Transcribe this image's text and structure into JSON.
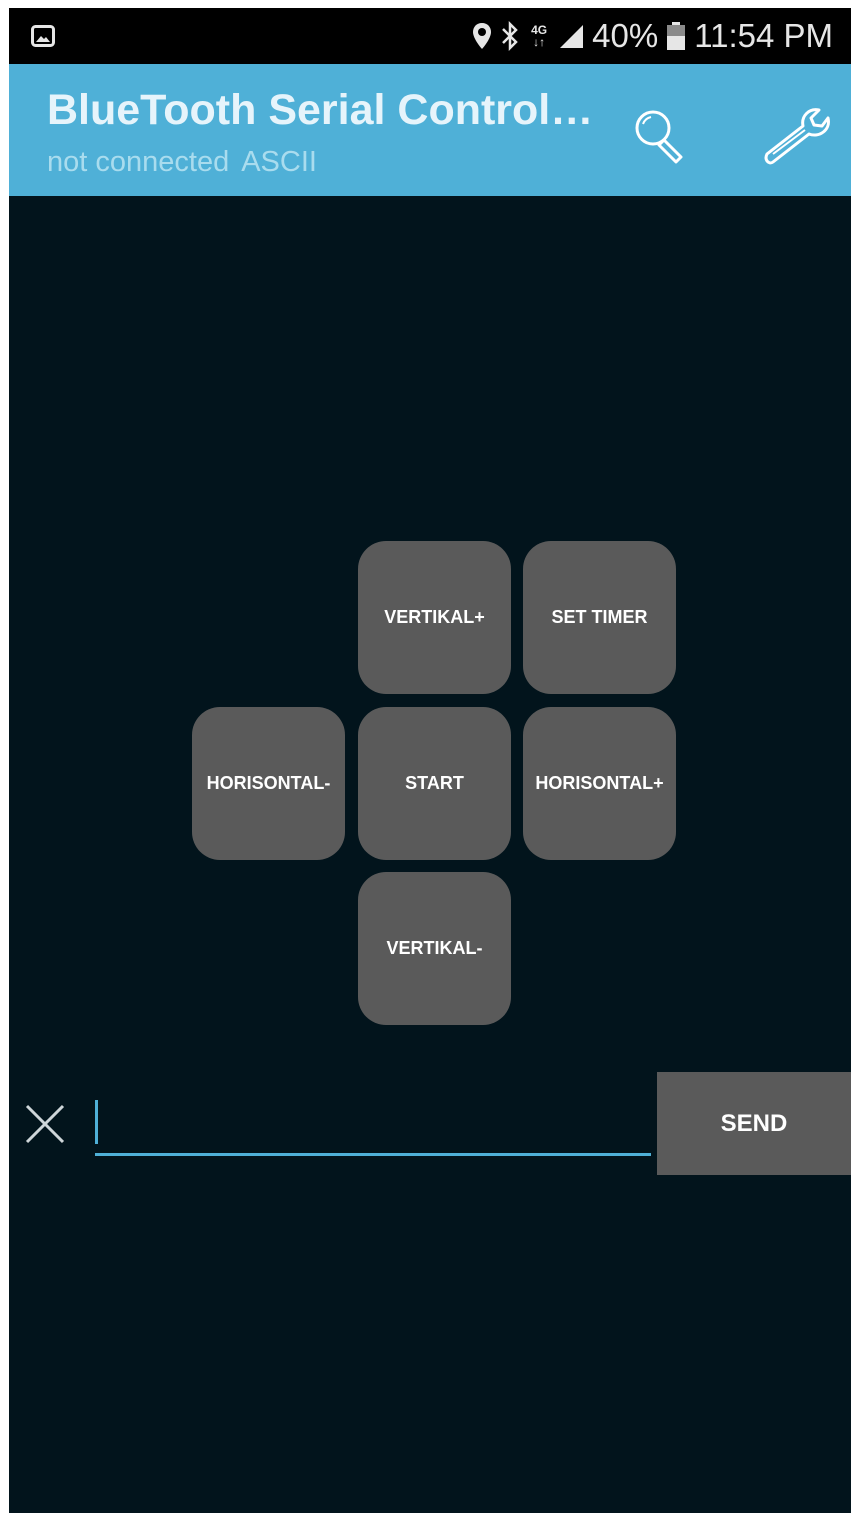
{
  "status_bar": {
    "icons": [
      "gallery-icon",
      "location-pin-icon",
      "bluetooth-icon",
      "network-4g-icon",
      "signal-icon",
      "battery-icon"
    ],
    "network_label": "4G",
    "battery_percent": "40%",
    "time": "11:54 PM"
  },
  "app_bar": {
    "title": "BlueTooth Serial Control…",
    "connection_status": "not connected",
    "mode": "ASCII",
    "actions": [
      "search-icon",
      "wrench-icon"
    ],
    "background_color": "#4fb0d7"
  },
  "pad": {
    "vertikal_plus": "VERTIKAL+",
    "set_timer": "SET TIMER",
    "horisontal_minus": "HORISONTAL-",
    "start": "START",
    "horisontal_plus": "HORISONTAL+",
    "vertikal_minus": "VERTIKAL-"
  },
  "input": {
    "value": "",
    "placeholder": "",
    "send_label": "SEND",
    "clear_icon": "close-icon"
  }
}
